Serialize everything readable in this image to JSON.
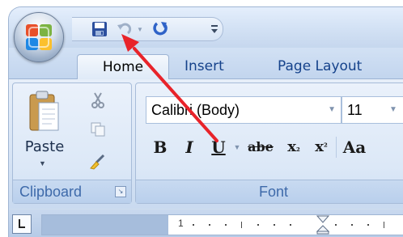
{
  "quick_access": {
    "office_button": "office-button",
    "items": [
      "save-icon",
      "undo-icon",
      "redo-icon",
      "customize-toolbar-icon"
    ]
  },
  "tabs": [
    {
      "label": "Home",
      "active": true
    },
    {
      "label": "Insert",
      "active": false
    },
    {
      "label": "Page Layout",
      "active": false
    }
  ],
  "clipboard": {
    "paste_label": "Paste",
    "group_label": "Clipboard"
  },
  "font": {
    "name_value": "Calibri (Body)",
    "size_value": "11",
    "group_label": "Font",
    "buttons": {
      "bold": "B",
      "italic": "I",
      "underline": "U",
      "strikethrough": "abe",
      "subscript": "x",
      "subscript_mark": "₂",
      "superscript": "x",
      "superscript_mark": "²",
      "change_case": "Aa"
    }
  },
  "ruler": {
    "number": "1"
  },
  "colors": {
    "accent_text": "#15428b",
    "group_label_text": "#3e6aaa",
    "annotation_arrow": "#e8232a"
  }
}
